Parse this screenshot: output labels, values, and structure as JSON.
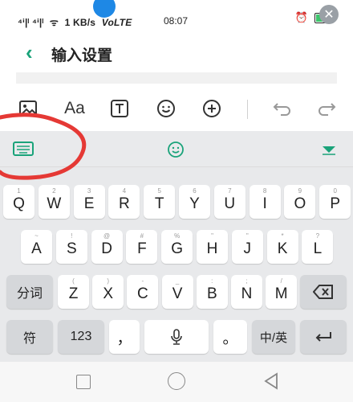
{
  "status": {
    "signal_text": "⁴ⁱ|ˡ ⁴ⁱ|ˡ",
    "speed": "1 KB/s",
    "network": "VoLTE",
    "time": "08:07"
  },
  "header": {
    "title": "输入设置"
  },
  "colors": {
    "accent": "#1aa37a",
    "annotation": "#e53935",
    "dot": "#1e88e5"
  },
  "rows": [
    [
      {
        "c": "Q",
        "h": "1"
      },
      {
        "c": "W",
        "h": "2"
      },
      {
        "c": "E",
        "h": "3"
      },
      {
        "c": "R",
        "h": "4"
      },
      {
        "c": "T",
        "h": "5"
      },
      {
        "c": "Y",
        "h": "6"
      },
      {
        "c": "U",
        "h": "7"
      },
      {
        "c": "I",
        "h": "8"
      },
      {
        "c": "O",
        "h": "9"
      },
      {
        "c": "P",
        "h": "0"
      }
    ],
    [
      {
        "c": "A",
        "h": "~"
      },
      {
        "c": "S",
        "h": "!"
      },
      {
        "c": "D",
        "h": "@"
      },
      {
        "c": "F",
        "h": "#"
      },
      {
        "c": "G",
        "h": "%"
      },
      {
        "c": "H",
        "h": "\""
      },
      {
        "c": "J",
        "h": "\""
      },
      {
        "c": "K",
        "h": "*"
      },
      {
        "c": "L",
        "h": "?"
      }
    ],
    [
      {
        "c": "Z",
        "h": "("
      },
      {
        "c": "X",
        "h": ")"
      },
      {
        "c": "C",
        "h": "-"
      },
      {
        "c": "V",
        "h": "_"
      },
      {
        "c": "B",
        "h": ":"
      },
      {
        "c": "N",
        "h": ";"
      },
      {
        "c": "M",
        "h": "/"
      }
    ]
  ],
  "keys": {
    "segment": "分词",
    "symbols": "符",
    "numbers": "123",
    "comma": "，",
    "period": "。",
    "lang": "中/英"
  }
}
